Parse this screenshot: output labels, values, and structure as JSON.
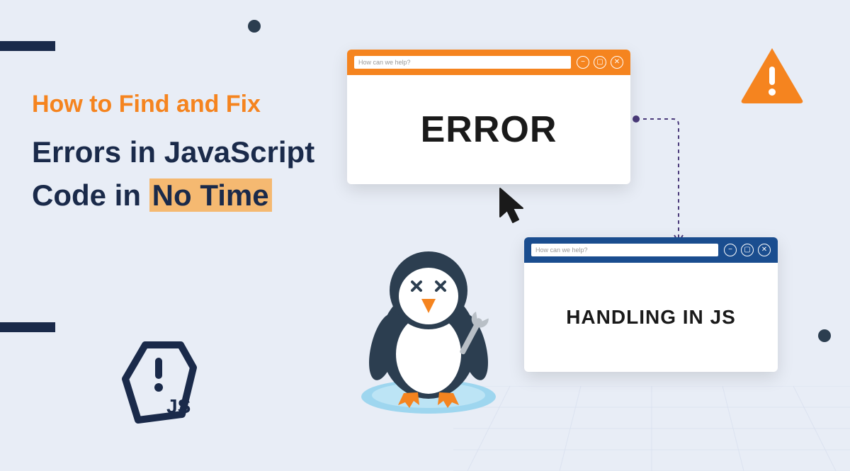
{
  "headline": {
    "line1": "How to Find and Fix",
    "line2_a": "Errors in JavaScript Code in ",
    "line2_highlight": "No Time"
  },
  "windows": {
    "error": {
      "search_placeholder": "How can we help?",
      "body": "ERROR"
    },
    "handling": {
      "search_placeholder": "How can we help?",
      "body": "HANDLING IN JS"
    }
  },
  "badge": {
    "text": "JS"
  },
  "colors": {
    "orange": "#f5841f",
    "blue": "#1a4d8f",
    "dark": "#1a2a4a",
    "bg": "#e8edf6",
    "highlight": "#f5b971"
  }
}
